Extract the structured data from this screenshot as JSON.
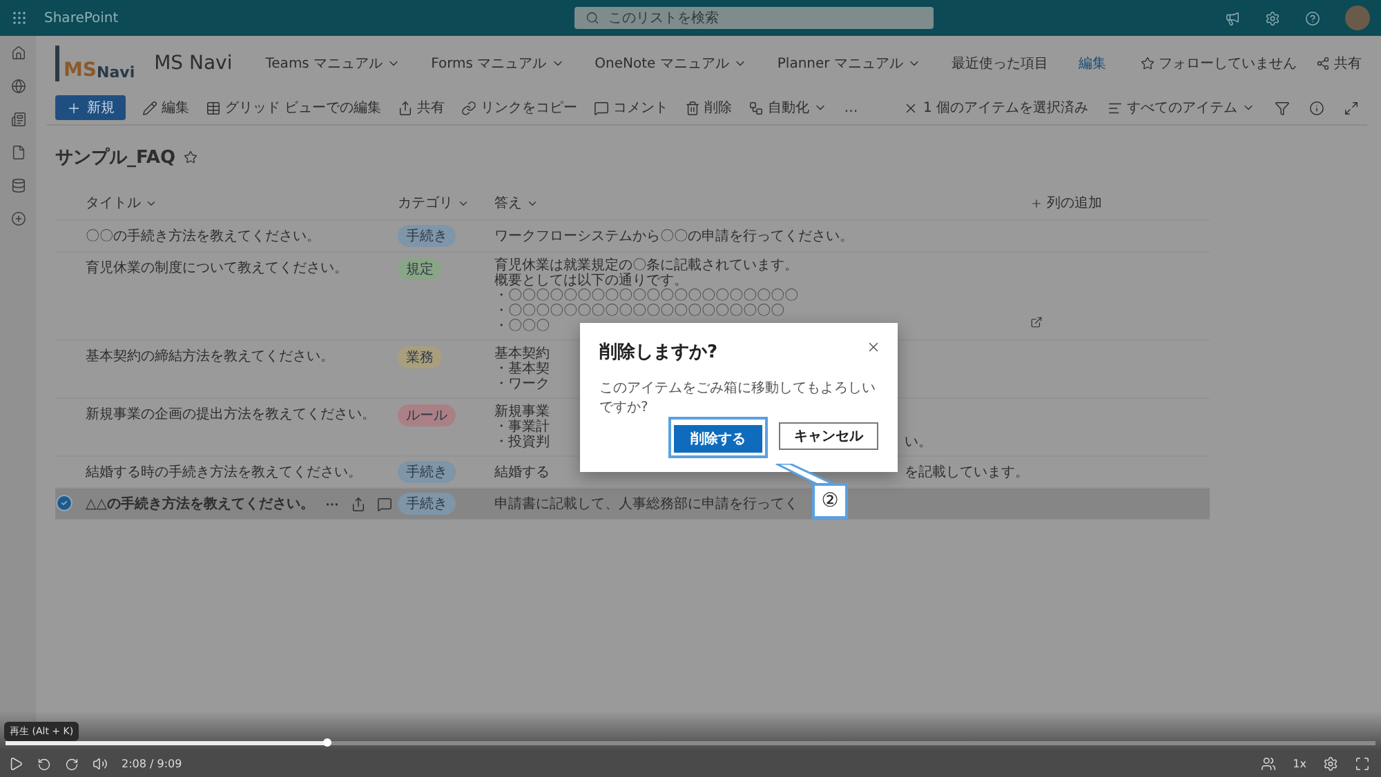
{
  "top_bar": {
    "app_name": "SharePoint",
    "search": {
      "placeholder": "このリストを検索"
    }
  },
  "site": {
    "logo": {
      "first": "MS",
      "second": "Navi"
    },
    "title": "MS Navi",
    "nav": [
      {
        "label": "Teams マニュアル",
        "dropdown": true
      },
      {
        "label": "Forms マニュアル",
        "dropdown": true
      },
      {
        "label": "OneNote マニュアル",
        "dropdown": true
      },
      {
        "label": "Planner マニュアル",
        "dropdown": true
      },
      {
        "label": "最近使った項目",
        "dropdown": false
      },
      {
        "label": "編集",
        "kind": "link",
        "dropdown": false
      }
    ],
    "follow": "フォローしていません",
    "share": "共有"
  },
  "command_bar": {
    "new": "新規",
    "items": [
      {
        "label": "編集",
        "dropdown": false
      },
      {
        "label": "グリッド ビューでの編集",
        "dropdown": false
      },
      {
        "label": "共有",
        "dropdown": false
      },
      {
        "label": "リンクをコピー",
        "dropdown": false
      },
      {
        "label": "コメント",
        "dropdown": false
      },
      {
        "label": "削除",
        "dropdown": false
      },
      {
        "label": "自動化",
        "dropdown": true
      }
    ],
    "more": "…",
    "selection": "1 個のアイテムを選択済み",
    "view": "すべてのアイテム"
  },
  "list": {
    "title": "サンプル_FAQ",
    "columns": [
      "タイトル",
      "カテゴリ",
      "答え"
    ],
    "add_column": "列の追加",
    "rows": [
      {
        "title": "〇〇の手続き方法を教えてください。",
        "category": {
          "label": "手続き",
          "color": "#7f95a8"
        },
        "answer_lines": [
          "ワークフローシステムから〇〇の申請を行ってください。"
        ],
        "selected": false
      },
      {
        "title": "育児休業の制度について教えてください。",
        "category": {
          "label": "規定",
          "color": "#8aa585"
        },
        "answer_lines": [
          "育児休業は就業規定の〇条に記載されています。",
          "概要としては以下の通りです。",
          "・〇〇〇〇〇〇〇〇〇〇〇〇〇〇〇〇〇〇〇〇〇",
          "・〇〇〇〇〇〇〇〇〇〇〇〇〇〇〇〇〇〇〇〇",
          "・〇〇〇"
        ],
        "selected": false
      },
      {
        "title": "基本契約の締結方法を教えてください。",
        "category": {
          "label": "業務",
          "color": "#aa9f7c"
        },
        "answer_lines": [
          "基本契約",
          "・基本契",
          "・ワーク"
        ],
        "selected": false
      },
      {
        "title": "新規事業の企画の提出方法を教えてください。",
        "category": {
          "label": "ルール",
          "color": "#aa8086"
        },
        "answer_lines": [
          "新規事業",
          "・事業計",
          "・投資判"
        ],
        "answer_tail": "い。",
        "selected": false
      },
      {
        "title": "結婚する時の手続き方法を教えてください。",
        "category": {
          "label": "手続き",
          "color": "#7f95a8"
        },
        "answer_lines": [
          "結婚する"
        ],
        "answer_tail": "を記載しています。",
        "selected": false
      },
      {
        "title": "△△の手続き方法を教えてください。",
        "category": {
          "label": "手続き",
          "color": "#7f95a8"
        },
        "answer_lines": [
          "申請書に記載して、人事総務部に申請を行ってく"
        ],
        "selected": true
      }
    ]
  },
  "dialog": {
    "title": "削除しますか?",
    "message": "このアイテムをごみ箱に移動してもよろしいですか?",
    "confirm": "削除する",
    "cancel": "キャンセル",
    "callout": "②"
  },
  "player": {
    "tooltip": "再生 (Alt + K)",
    "level": 0.235,
    "time": "2:08 / 9:09",
    "speed": "1x"
  }
}
